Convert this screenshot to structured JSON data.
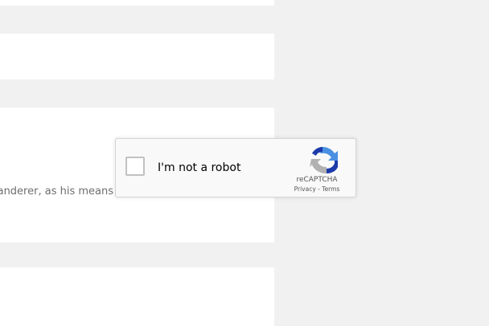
{
  "page": {
    "background_color": "#f1f1f1",
    "card_color": "#ffffff"
  },
  "article": {
    "snippet_text": "wanderer, as his means"
  },
  "recaptcha": {
    "checkbox_label": "I'm not a robot",
    "brand": "reCAPTCHA",
    "privacy_link": "Privacy",
    "separator": " - ",
    "terms_link": "Terms",
    "logo_icon": "recaptcha-logo-icon",
    "colors": {
      "logo_blue_dark": "#1c3aa9",
      "logo_blue_light": "#4a90e2",
      "logo_gray": "#b1b1b1"
    }
  }
}
